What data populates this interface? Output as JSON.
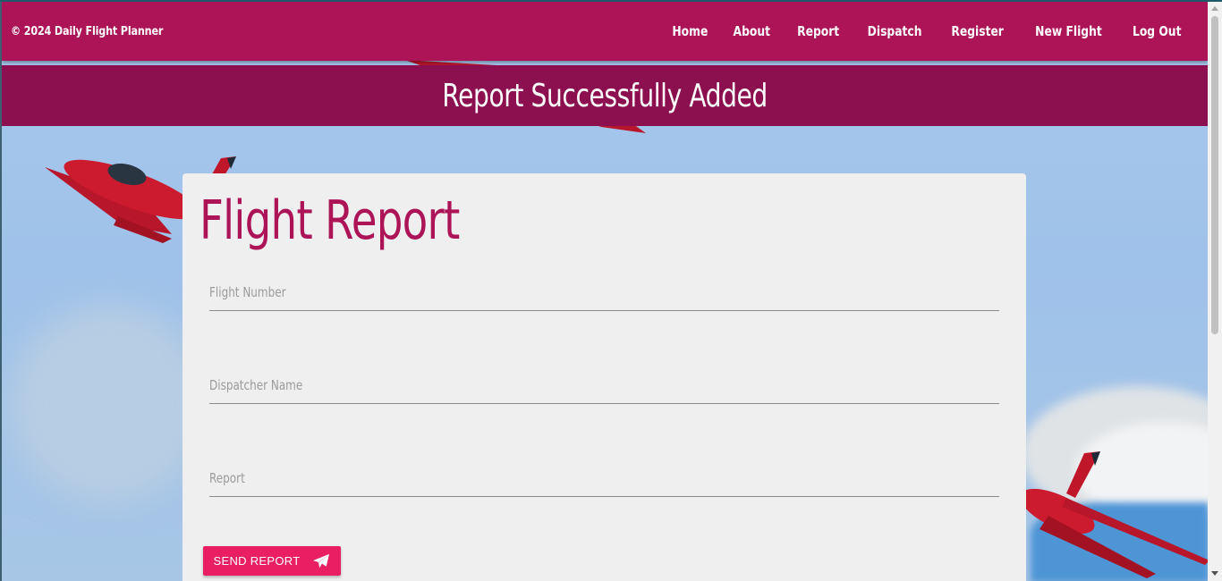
{
  "navbar": {
    "brand": "© 2024 Daily Flight Planner",
    "links": [
      "Home",
      "About",
      "Report",
      "Dispatch",
      "Register",
      "New Flight",
      "Log Out"
    ]
  },
  "banner": {
    "message": "Report Successfully Added"
  },
  "form": {
    "title": "Flight Report",
    "fields": [
      {
        "label": "Flight Number",
        "value": ""
      },
      {
        "label": "Dispatcher Name",
        "value": ""
      },
      {
        "label": "Report",
        "value": ""
      }
    ],
    "submit_label": "SEND REPORT",
    "submit_icon": "paper-plane-icon"
  },
  "colors": {
    "navbar": "#ad1457",
    "banner": "#8c0f4f",
    "accent": "#e91e63",
    "card": "#efefef"
  }
}
